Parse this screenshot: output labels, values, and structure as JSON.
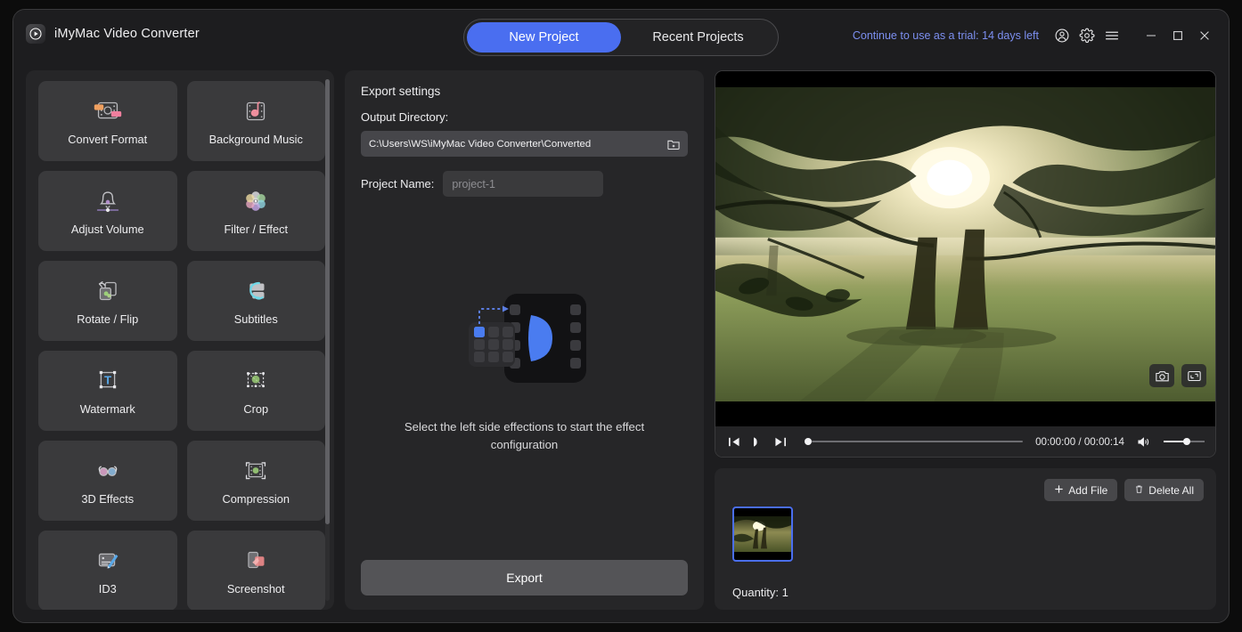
{
  "app": {
    "title": "iMyMac Video Converter",
    "logo_icon": "play-circle-logo"
  },
  "header": {
    "tabs": [
      {
        "label": "New Project",
        "active": true
      },
      {
        "label": "Recent Projects",
        "active": false
      }
    ],
    "trial_text": "Continue to use as a trial: 14 days left",
    "account_icon": "account-circle-icon",
    "settings_icon": "gear-icon",
    "menu_icon": "hamburger-menu-icon",
    "minimize_icon": "minimize-icon",
    "maximize_icon": "maximize-icon",
    "close_icon": "close-icon"
  },
  "sidebar": {
    "tools": [
      {
        "label": "Convert Format",
        "icon": "convert-format-icon"
      },
      {
        "label": "Background Music",
        "icon": "background-music-icon"
      },
      {
        "label": "Adjust Volume",
        "icon": "adjust-volume-icon"
      },
      {
        "label": "Filter / Effect",
        "icon": "filter-effect-icon"
      },
      {
        "label": "Rotate / Flip",
        "icon": "rotate-flip-icon"
      },
      {
        "label": "Subtitles",
        "icon": "subtitles-icon"
      },
      {
        "label": "Watermark",
        "icon": "watermark-icon"
      },
      {
        "label": "Crop",
        "icon": "crop-icon"
      },
      {
        "label": "3D Effects",
        "icon": "3d-effects-icon"
      },
      {
        "label": "Compression",
        "icon": "compression-icon"
      },
      {
        "label": "ID3",
        "icon": "id3-icon"
      },
      {
        "label": "Screenshot",
        "icon": "screenshot-icon"
      }
    ]
  },
  "export_panel": {
    "section_title": "Export settings",
    "output_label": "Output Directory:",
    "output_path": "C:\\Users\\WS\\iMyMac Video Converter\\Converted",
    "folder_icon": "folder-browse-icon",
    "project_name_label": "Project Name:",
    "project_name_value": "",
    "project_name_placeholder": "project-1",
    "placeholder_text": "Select the left side effections to start the effect configuration",
    "placeholder_art_icon": "effects-placeholder-illustration",
    "export_label": "Export"
  },
  "preview": {
    "snapshot_icon": "camera-snapshot-icon",
    "fullscreen_icon": "fullscreen-icon",
    "prev_icon": "skip-previous-icon",
    "play_icon": "play-icon",
    "next_icon": "skip-next-icon",
    "current_time": "00:00:00",
    "total_time": "00:00:14",
    "time_display": "00:00:00 / 00:00:14",
    "volume_icon": "volume-icon",
    "volume_percent": 60,
    "seek_percent": 0
  },
  "files": {
    "add_file_label": "Add File",
    "add_file_icon": "plus-icon",
    "delete_all_label": "Delete All",
    "delete_all_icon": "trash-icon",
    "quantity_label": "Quantity: 1",
    "items": [
      {
        "name": "thumbnail-1",
        "selected": true
      }
    ]
  },
  "colors": {
    "accent": "#4a6ef0",
    "trial_link": "#7c8ff0",
    "panel": "#262628",
    "tile": "#3a3a3c",
    "window": "#1d1d1f"
  }
}
